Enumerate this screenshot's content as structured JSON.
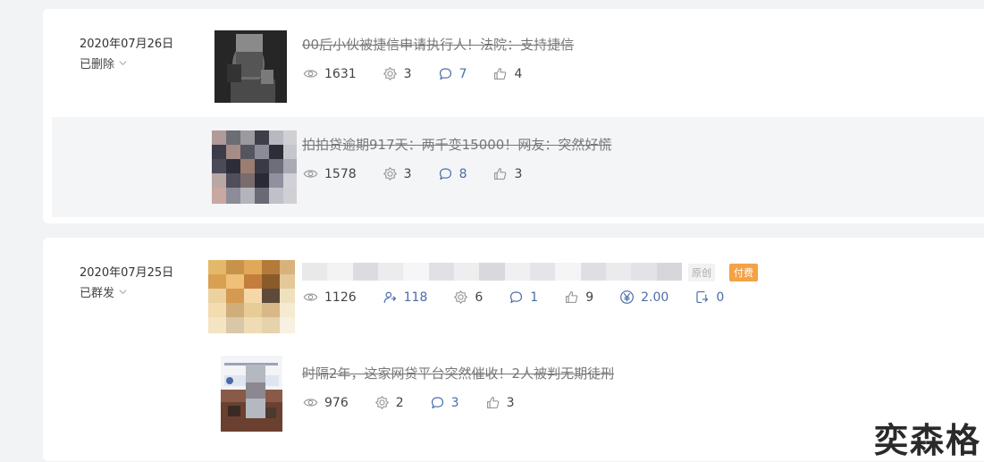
{
  "posts": [
    {
      "date": "2020年07月26日",
      "status": "已删除",
      "items": [
        {
          "title": "00后小伙被捷信申请执行人！法院：支持捷信",
          "stats": {
            "views": "1631",
            "shares": "3",
            "comments": "7",
            "likes": "4"
          }
        },
        {
          "title": "拍拍贷逾期917天：两千变15000！网友：突然好慌",
          "stats": {
            "views": "1578",
            "shares": "3",
            "comments": "8",
            "likes": "3"
          }
        }
      ]
    },
    {
      "date": "2020年07月25日",
      "status": "已群发",
      "items": [
        {
          "tag_original": "原创",
          "tag_paid": "付费",
          "stats": {
            "views": "1126",
            "forwards": "118",
            "shares": "6",
            "comments": "1",
            "likes": "9",
            "paid": "2.00",
            "reprints": "0"
          }
        },
        {
          "title": "时隔2年，这家网贷平台突然催收！2人被判无期徒刑",
          "stats": {
            "views": "976",
            "shares": "2",
            "comments": "3",
            "likes": "3"
          }
        }
      ]
    }
  ],
  "watermark": "奕森格",
  "colors": {
    "accent_blue": "#4a6da8",
    "paid_tag": "#f3a246",
    "page_bg": "#f2f3f5"
  }
}
